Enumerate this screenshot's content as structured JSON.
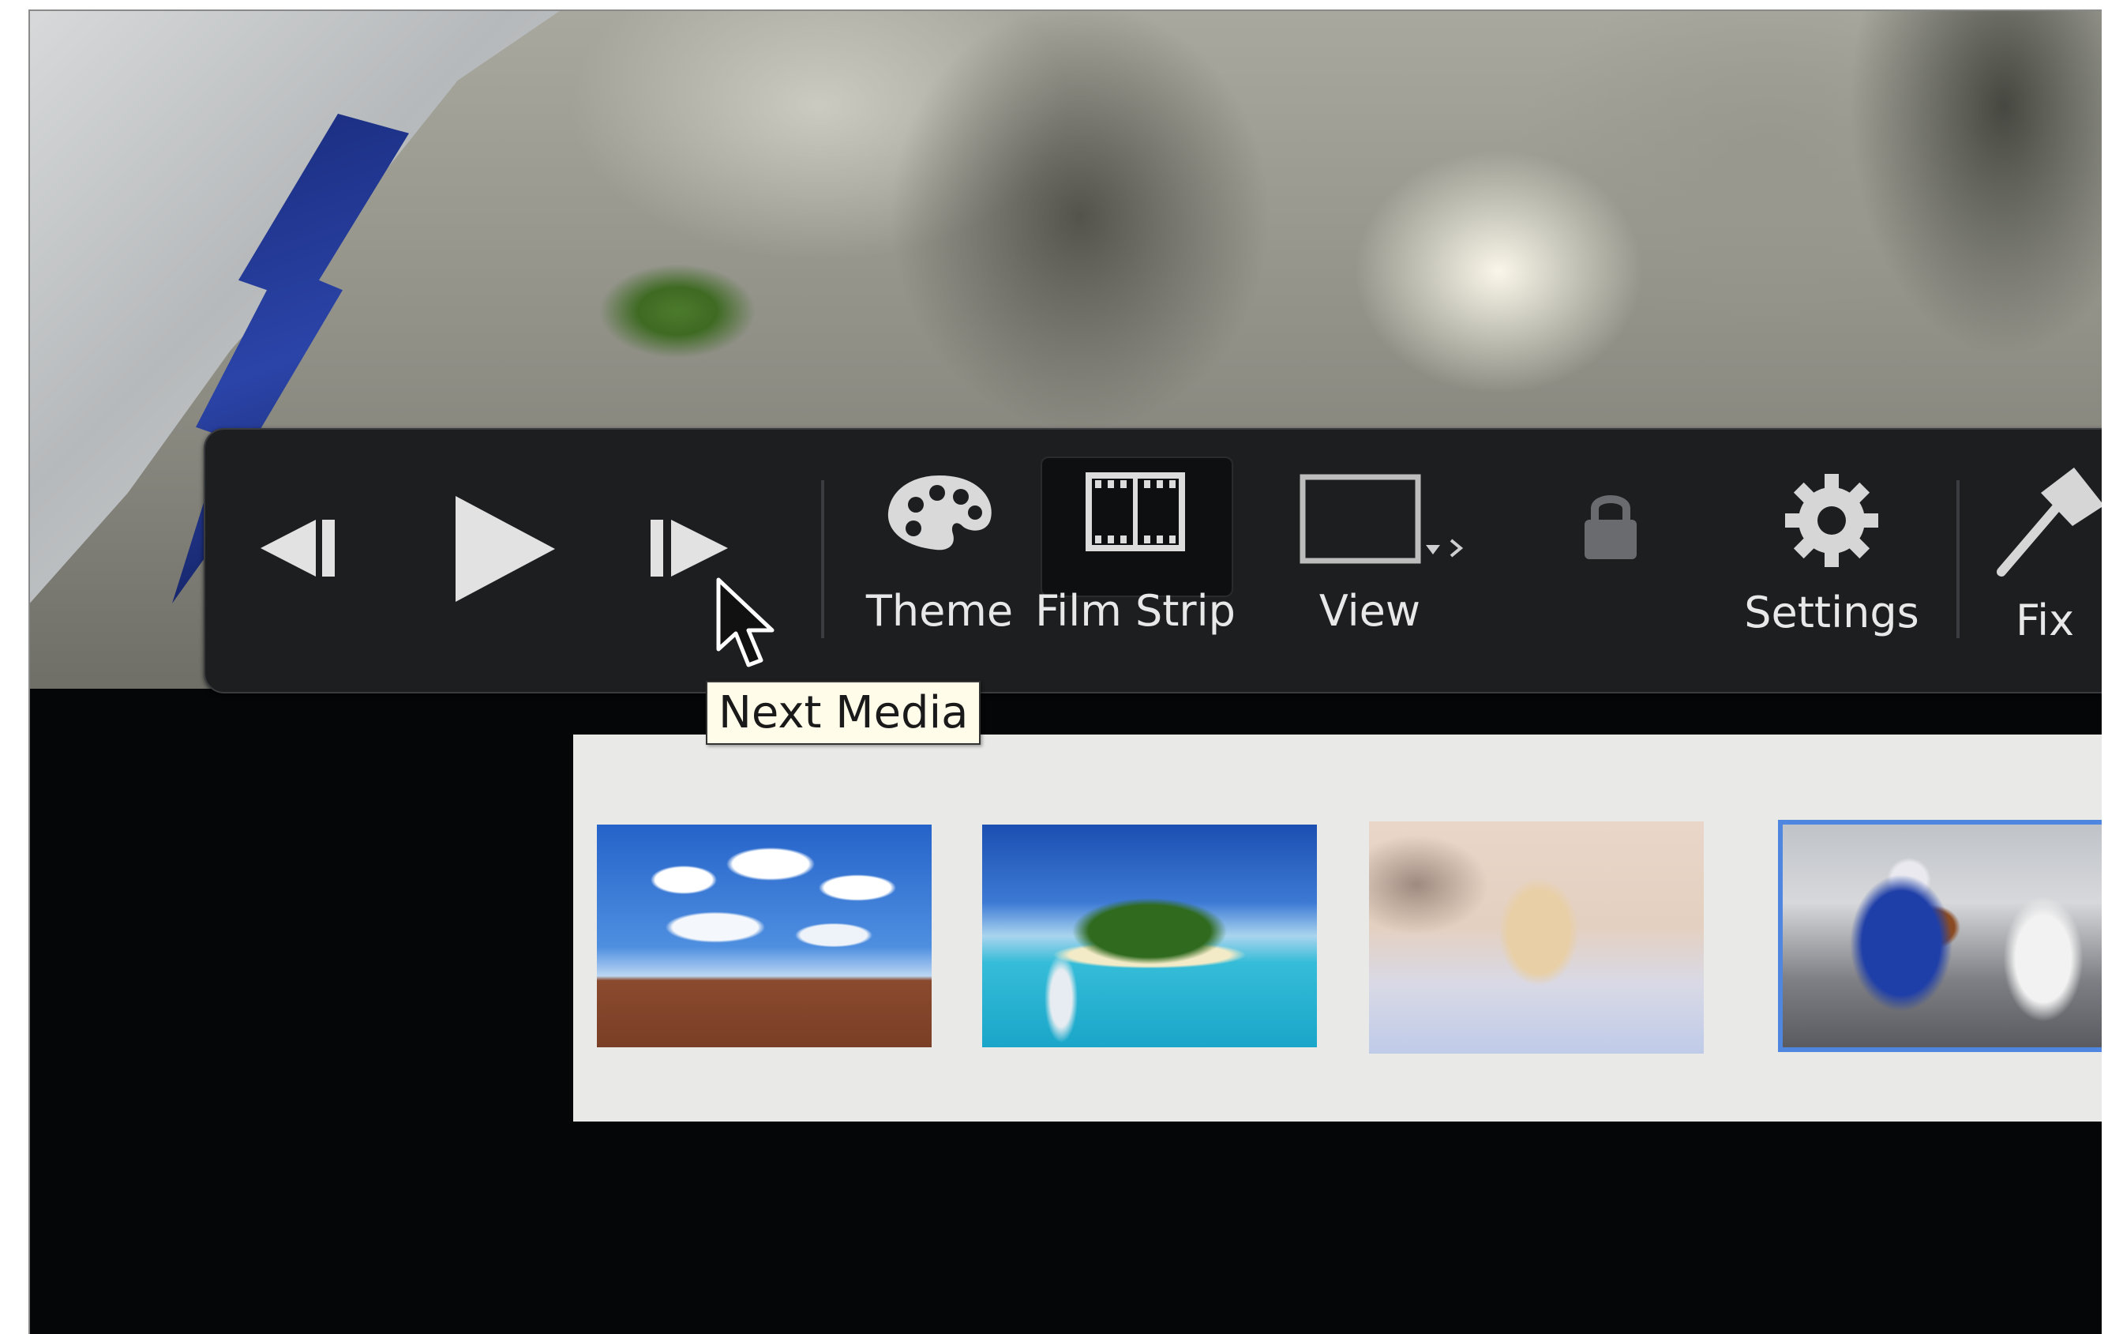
{
  "toolbar": {
    "buttons": [
      {
        "id": "previous",
        "icon": "previous-media-icon",
        "label": ""
      },
      {
        "id": "play",
        "icon": "play-icon",
        "label": ""
      },
      {
        "id": "next",
        "icon": "next-media-icon",
        "label": ""
      },
      {
        "id": "theme",
        "icon": "palette-icon",
        "label": "Theme"
      },
      {
        "id": "film_strip",
        "icon": "film-strip-icon",
        "label": "Film Strip"
      },
      {
        "id": "view",
        "icon": "view-rectangle-icon",
        "label": "View"
      },
      {
        "id": "lock",
        "icon": "lock-icon",
        "label": ""
      },
      {
        "id": "settings",
        "icon": "gear-icon",
        "label": "Settings"
      },
      {
        "id": "fix",
        "icon": "squeegee-icon",
        "label": "Fix"
      }
    ]
  },
  "tooltip": {
    "text": "Next Media"
  },
  "film_strip": {
    "thumbnails": [
      {
        "name": "sky-field",
        "selected": false
      },
      {
        "name": "tropical-island",
        "selected": false
      },
      {
        "name": "white-horse",
        "selected": false
      },
      {
        "name": "football-player",
        "selected": true
      }
    ],
    "selection_color": "#4f86e0"
  }
}
